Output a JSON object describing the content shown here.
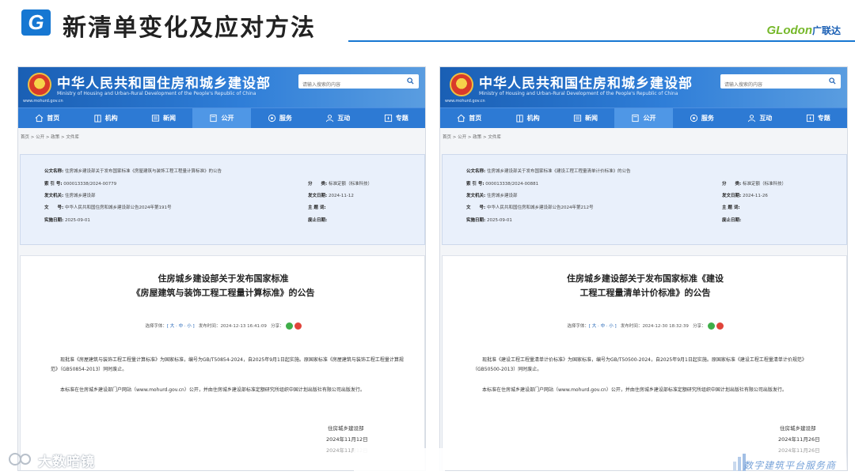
{
  "slide": {
    "logo_letter": "G",
    "title": "新清单变化及应对方法",
    "brand_en": "GLodon",
    "brand_cn": "广联达",
    "accent": "#1677d2"
  },
  "site": {
    "ministry": "中华人民共和国住房和城乡建设部",
    "ministry_en": "Ministry of Housing and Urban-Rural Development of the People's Republic of China",
    "url": "www.mohurd.gov.cn",
    "search_placeholder": "请输入搜索的内容",
    "nav": [
      "首页",
      "机构",
      "新闻",
      "公开",
      "服务",
      "互动",
      "专题"
    ],
    "nav_active": "公开",
    "breadcrumb": "首页 > 公开 > 政策 > 文件库",
    "labels": {
      "name": "公文名称:",
      "index": "索 引 号:",
      "issuer": "发文机关:",
      "doc_no": "文　　号:",
      "impl_date": "实施日期:",
      "category": "分　　类:",
      "issue_date": "发文日期:",
      "subject": "主 题 词:",
      "abolish_date": "废止日期:"
    },
    "fontsize_label": "选择字体：",
    "fontsize_options": "[ 大 · 中 · 小 ]",
    "publish_label": "发布时间：",
    "share_label": "分享："
  },
  "left": {
    "name": "住房城乡建设部关于发布国家标准《房屋建筑与装饰工程工程量计算标准》的公告",
    "index": "000013338/2024-00779",
    "issuer": "住房城乡建设部",
    "doc_no": "中华人民共和国住房和城乡建设部公告2024年第191号",
    "impl_date": "2025-09-01",
    "category": "标准定额（标准科技）",
    "issue_date": "2024-11-12",
    "title_line1": "住房城乡建设部关于发布国家标准",
    "title_line2": "《房屋建筑与装饰工程工程量计算标准》的公告",
    "publish_time": "2024-12-13 16:41:09",
    "para1": "现批准《房屋建筑与装饰工程工程量计算标准》为国家标准，编号为GB/T50854-2024，自2025年9月1日起实施。原国家标准《房屋建筑与装饰工程工程量计算规范》（GB50854-2013）同时废止。",
    "para2": "本标准在住房城乡建设部门户网站（www.mohurd.gov.cn）公开，并由住房城乡建设部标准定额研究所组织中国计划出版社有限公司出版发行。",
    "sign_org": "住房城乡建设部",
    "sign_date": "2024年11月12日",
    "sign_date_faded": "2024年11月12日"
  },
  "right": {
    "name": "住房城乡建设部关于发布国家标准《建设工程工程量清单计价标准》的公告",
    "index": "000013338/2024-00881",
    "issuer": "住房城乡建设部",
    "doc_no": "中华人民共和国住房和城乡建设部公告2024年第212号",
    "impl_date": "2025-09-01",
    "category": "标准定额（标准科技）",
    "issue_date": "2024-11-26",
    "title_line1": "住房城乡建设部关于发布国家标准《建设",
    "title_line2": "工程工程量清单计价标准》的公告",
    "publish_time": "2024-12-30 18:32:39",
    "para1": "现批准《建设工程工程量清单计价标准》为国家标准，编号为GB/T50500-2024，自2025年9月1日起实施。原国家标准《建设工程工程量清单计价规范》（GB50500-2013）同时废止。",
    "para2": "本标准在住房城乡建设部门户网站（www.mohurd.gov.cn）公开，并由住房城乡建设部标准定额研究所组织中国计划出版社有限公司出版发行。",
    "sign_org": "住房城乡建设部",
    "sign_date": "2024年11月26日",
    "sign_date_faded": "2024年11月26日"
  },
  "watermark_left": "大数暗镜",
  "watermark_right": "数字建筑平台服务商"
}
